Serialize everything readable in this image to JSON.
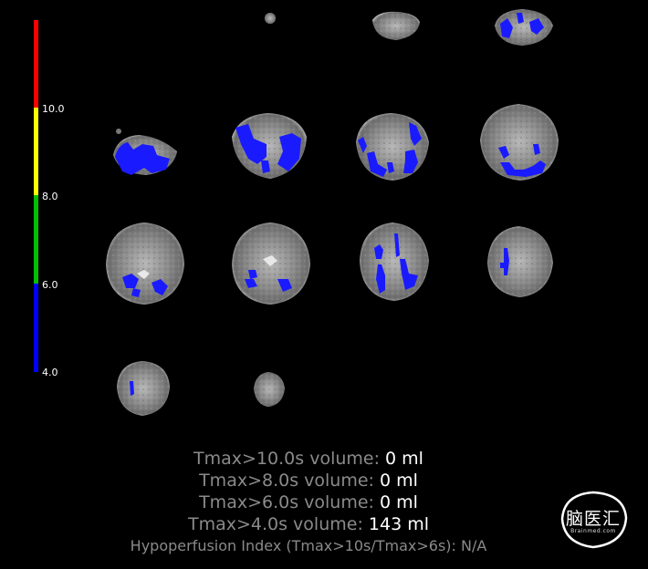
{
  "colorbar": {
    "ticks": [
      "10.0",
      "8.0",
      "6.0",
      "4.0"
    ],
    "colors": [
      "#ff0000",
      "#ffff00",
      "#00c000",
      "#0000ff"
    ]
  },
  "perfusion_color": "#1a1aff",
  "stats": {
    "tmax10": {
      "label": "Tmax>10.0s volume:",
      "value": "0 ml"
    },
    "tmax8": {
      "label": "Tmax>8.0s volume:",
      "value": "0 ml"
    },
    "tmax6": {
      "label": "Tmax>6.0s volume:",
      "value": "0 ml"
    },
    "tmax4": {
      "label": "Tmax>4.0s volume:",
      "value": "143 ml"
    },
    "hypoperfusion": {
      "label": "Hypoperfusion Index (Tmax>10s/Tmax>6s):",
      "value": "N/A"
    }
  },
  "logo": {
    "text": "脑医汇",
    "subtext": "Brainmed.com"
  }
}
